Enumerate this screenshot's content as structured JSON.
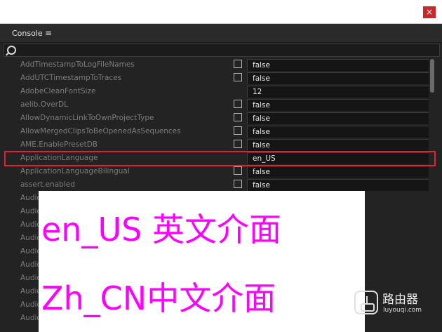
{
  "window": {
    "close_glyph": "×"
  },
  "panel": {
    "title": "Console",
    "menu_glyph": "≡"
  },
  "rows": [
    {
      "name": "AddTimestampToLogFileNames",
      "checkbox": true,
      "value": "false"
    },
    {
      "name": "AddUTCTimestampToTraces",
      "checkbox": true,
      "value": "false"
    },
    {
      "name": "AdobeCleanFontSize",
      "checkbox": false,
      "value": "12"
    },
    {
      "name": "aelib.OverDL",
      "checkbox": true,
      "value": "false"
    },
    {
      "name": "AllowDynamicLinkToOwnProjectType",
      "checkbox": true,
      "value": "false"
    },
    {
      "name": "AllowMergedClipsToBeOpenedAsSequences",
      "checkbox": true,
      "value": "false"
    },
    {
      "name": "AME.EnablePresetDB",
      "checkbox": true,
      "value": "false"
    },
    {
      "name": "ApplicationLanguage",
      "checkbox": false,
      "value": "en_US"
    },
    {
      "name": "ApplicationLanguageBilingual",
      "checkbox": true,
      "value": "false"
    },
    {
      "name": "assert.enabled",
      "checkbox": true,
      "value": "false"
    },
    {
      "name": "Audio",
      "checkbox": false,
      "value": ""
    },
    {
      "name": "Audio",
      "checkbox": false,
      "value": ""
    },
    {
      "name": "Audio",
      "checkbox": false,
      "value": ""
    },
    {
      "name": "Audio",
      "checkbox": false,
      "value": ""
    },
    {
      "name": "Audio",
      "checkbox": false,
      "value": ""
    },
    {
      "name": "Audio",
      "checkbox": false,
      "value": ""
    },
    {
      "name": "Audio",
      "checkbox": false,
      "value": ""
    },
    {
      "name": "Audio",
      "checkbox": false,
      "value": ""
    },
    {
      "name": "Audio",
      "checkbox": false,
      "value": ""
    },
    {
      "name": "Audio",
      "checkbox": false,
      "value": ""
    }
  ],
  "overlay": {
    "line1": "en_US 英文介面",
    "line2": "Zh_CN中文介面",
    "color": "#ff00ff"
  },
  "watermark": {
    "name": "路由器",
    "url": "luyouqi.com"
  },
  "colors": {
    "highlight": "#e02231",
    "close_button": "#c9282d",
    "background": "#232323"
  }
}
